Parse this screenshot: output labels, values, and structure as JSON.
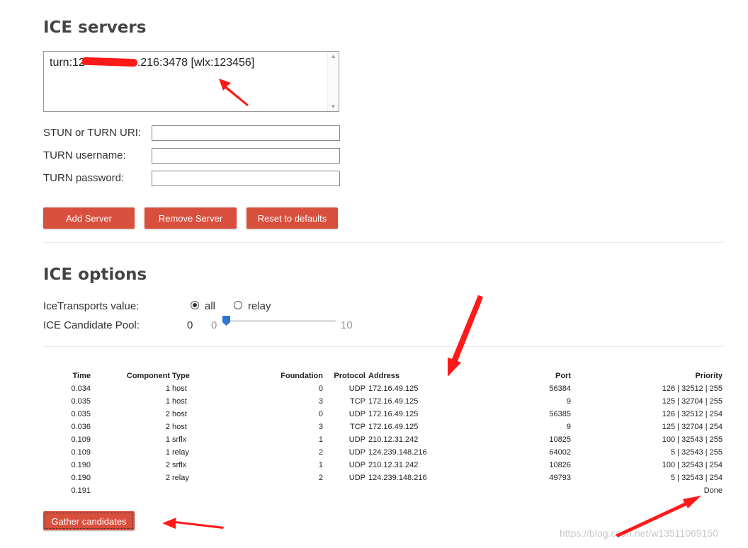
{
  "servers_section": {
    "title": "ICE servers",
    "entry_prefix": "turn:12",
    "entry_suffix": ".216:3478 [wlx:123456]",
    "uri_label": "STUN or TURN URI:",
    "username_label": "TURN username:",
    "password_label": "TURN password:",
    "uri_value": "",
    "username_value": "",
    "password_value": "",
    "add_label": "Add Server",
    "remove_label": "Remove Server",
    "reset_label": "Reset to defaults"
  },
  "options_section": {
    "title": "ICE options",
    "transports_label": "IceTransports value:",
    "transport_options": [
      "all",
      "relay"
    ],
    "transport_selected": "all",
    "pool_label": "ICE Candidate Pool:",
    "pool_value": "0",
    "pool_min": "0",
    "pool_max": "10",
    "pool_level": 0
  },
  "candidates": {
    "headers": [
      "Time",
      "Component",
      "Type",
      "Foundation",
      "Protocol",
      "Address",
      "Port",
      "Priority"
    ],
    "rows": [
      [
        "0.034",
        "1",
        "host",
        "0",
        "UDP",
        "172.16.49.125",
        "56384",
        "126 | 32512 | 255"
      ],
      [
        "0.035",
        "1",
        "host",
        "3",
        "TCP",
        "172.16.49.125",
        "9",
        "125 | 32704 | 255"
      ],
      [
        "0.035",
        "2",
        "host",
        "0",
        "UDP",
        "172.16.49.125",
        "56385",
        "126 | 32512 | 254"
      ],
      [
        "0.036",
        "2",
        "host",
        "3",
        "TCP",
        "172.16.49.125",
        "9",
        "125 | 32704 | 254"
      ],
      [
        "0.109",
        "1",
        "srflx",
        "1",
        "UDP",
        "210.12.31.242",
        "10825",
        "100 | 32543 | 255"
      ],
      [
        "0.109",
        "1",
        "relay",
        "2",
        "UDP",
        "124.239.148.216",
        "64002",
        "5 | 32543 | 255"
      ],
      [
        "0.190",
        "2",
        "srflx",
        "1",
        "UDP",
        "210.12.31.242",
        "10826",
        "100 | 32543 | 254"
      ],
      [
        "0.190",
        "2",
        "relay",
        "2",
        "UDP",
        "124.239.148.216",
        "49793",
        "5 | 32543 | 254"
      ]
    ],
    "final_time": "0.191",
    "final_status": "Done"
  },
  "gather_label": "Gather candidates",
  "watermark": "https://blog.csdn.net/w13511069150",
  "colors": {
    "button": "#d94f3d",
    "annotation": "#ff1a1a",
    "slider": "#2a76d2"
  }
}
